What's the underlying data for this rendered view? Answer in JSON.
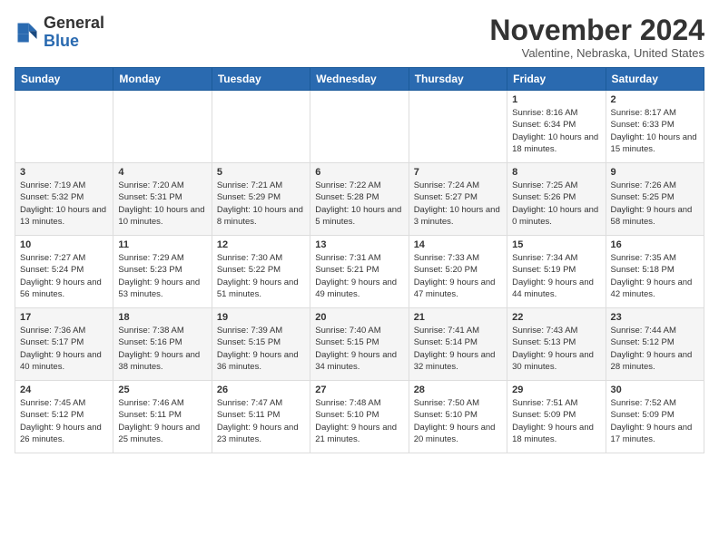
{
  "header": {
    "logo": {
      "line1": "General",
      "line2": "Blue"
    },
    "title": "November 2024",
    "subtitle": "Valentine, Nebraska, United States"
  },
  "weekdays": [
    "Sunday",
    "Monday",
    "Tuesday",
    "Wednesday",
    "Thursday",
    "Friday",
    "Saturday"
  ],
  "weeks": [
    [
      {
        "day": "",
        "info": ""
      },
      {
        "day": "",
        "info": ""
      },
      {
        "day": "",
        "info": ""
      },
      {
        "day": "",
        "info": ""
      },
      {
        "day": "",
        "info": ""
      },
      {
        "day": "1",
        "info": "Sunrise: 8:16 AM\nSunset: 6:34 PM\nDaylight: 10 hours and 18 minutes."
      },
      {
        "day": "2",
        "info": "Sunrise: 8:17 AM\nSunset: 6:33 PM\nDaylight: 10 hours and 15 minutes."
      }
    ],
    [
      {
        "day": "3",
        "info": "Sunrise: 7:19 AM\nSunset: 5:32 PM\nDaylight: 10 hours and 13 minutes."
      },
      {
        "day": "4",
        "info": "Sunrise: 7:20 AM\nSunset: 5:31 PM\nDaylight: 10 hours and 10 minutes."
      },
      {
        "day": "5",
        "info": "Sunrise: 7:21 AM\nSunset: 5:29 PM\nDaylight: 10 hours and 8 minutes."
      },
      {
        "day": "6",
        "info": "Sunrise: 7:22 AM\nSunset: 5:28 PM\nDaylight: 10 hours and 5 minutes."
      },
      {
        "day": "7",
        "info": "Sunrise: 7:24 AM\nSunset: 5:27 PM\nDaylight: 10 hours and 3 minutes."
      },
      {
        "day": "8",
        "info": "Sunrise: 7:25 AM\nSunset: 5:26 PM\nDaylight: 10 hours and 0 minutes."
      },
      {
        "day": "9",
        "info": "Sunrise: 7:26 AM\nSunset: 5:25 PM\nDaylight: 9 hours and 58 minutes."
      }
    ],
    [
      {
        "day": "10",
        "info": "Sunrise: 7:27 AM\nSunset: 5:24 PM\nDaylight: 9 hours and 56 minutes."
      },
      {
        "day": "11",
        "info": "Sunrise: 7:29 AM\nSunset: 5:23 PM\nDaylight: 9 hours and 53 minutes."
      },
      {
        "day": "12",
        "info": "Sunrise: 7:30 AM\nSunset: 5:22 PM\nDaylight: 9 hours and 51 minutes."
      },
      {
        "day": "13",
        "info": "Sunrise: 7:31 AM\nSunset: 5:21 PM\nDaylight: 9 hours and 49 minutes."
      },
      {
        "day": "14",
        "info": "Sunrise: 7:33 AM\nSunset: 5:20 PM\nDaylight: 9 hours and 47 minutes."
      },
      {
        "day": "15",
        "info": "Sunrise: 7:34 AM\nSunset: 5:19 PM\nDaylight: 9 hours and 44 minutes."
      },
      {
        "day": "16",
        "info": "Sunrise: 7:35 AM\nSunset: 5:18 PM\nDaylight: 9 hours and 42 minutes."
      }
    ],
    [
      {
        "day": "17",
        "info": "Sunrise: 7:36 AM\nSunset: 5:17 PM\nDaylight: 9 hours and 40 minutes."
      },
      {
        "day": "18",
        "info": "Sunrise: 7:38 AM\nSunset: 5:16 PM\nDaylight: 9 hours and 38 minutes."
      },
      {
        "day": "19",
        "info": "Sunrise: 7:39 AM\nSunset: 5:15 PM\nDaylight: 9 hours and 36 minutes."
      },
      {
        "day": "20",
        "info": "Sunrise: 7:40 AM\nSunset: 5:15 PM\nDaylight: 9 hours and 34 minutes."
      },
      {
        "day": "21",
        "info": "Sunrise: 7:41 AM\nSunset: 5:14 PM\nDaylight: 9 hours and 32 minutes."
      },
      {
        "day": "22",
        "info": "Sunrise: 7:43 AM\nSunset: 5:13 PM\nDaylight: 9 hours and 30 minutes."
      },
      {
        "day": "23",
        "info": "Sunrise: 7:44 AM\nSunset: 5:12 PM\nDaylight: 9 hours and 28 minutes."
      }
    ],
    [
      {
        "day": "24",
        "info": "Sunrise: 7:45 AM\nSunset: 5:12 PM\nDaylight: 9 hours and 26 minutes."
      },
      {
        "day": "25",
        "info": "Sunrise: 7:46 AM\nSunset: 5:11 PM\nDaylight: 9 hours and 25 minutes."
      },
      {
        "day": "26",
        "info": "Sunrise: 7:47 AM\nSunset: 5:11 PM\nDaylight: 9 hours and 23 minutes."
      },
      {
        "day": "27",
        "info": "Sunrise: 7:48 AM\nSunset: 5:10 PM\nDaylight: 9 hours and 21 minutes."
      },
      {
        "day": "28",
        "info": "Sunrise: 7:50 AM\nSunset: 5:10 PM\nDaylight: 9 hours and 20 minutes."
      },
      {
        "day": "29",
        "info": "Sunrise: 7:51 AM\nSunset: 5:09 PM\nDaylight: 9 hours and 18 minutes."
      },
      {
        "day": "30",
        "info": "Sunrise: 7:52 AM\nSunset: 5:09 PM\nDaylight: 9 hours and 17 minutes."
      }
    ]
  ]
}
